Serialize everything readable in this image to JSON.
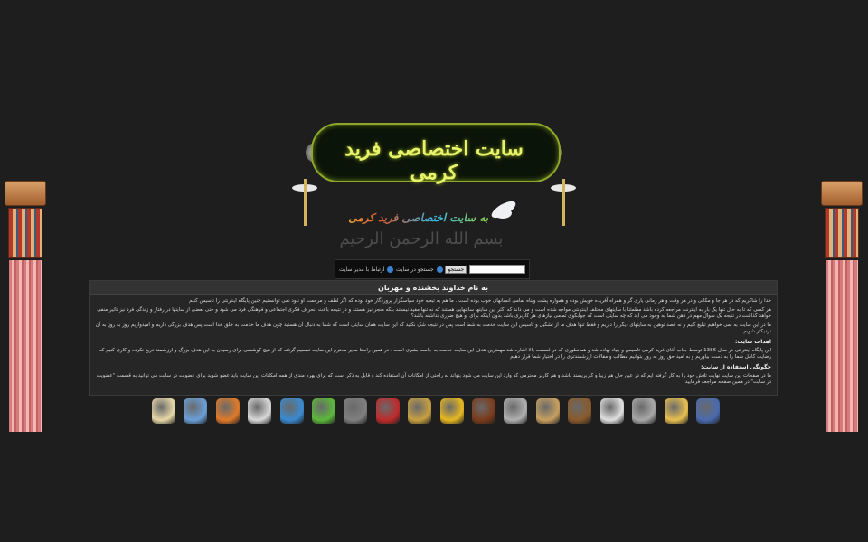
{
  "banner": {
    "title": "سایت اختصاصی فرید کرمی"
  },
  "welcome_text": "به سایت اختصاصی فرید کرمی",
  "basmala": "بسم الله الرحمن الرحیم",
  "navbar": {
    "search_button": "جستجو",
    "search_label": "جستجو در سایت",
    "contact_label": "ارتباط با مدیر سایت"
  },
  "content": {
    "heading": "به نام خداوند بخشنده و مهربان",
    "intro": "خدا را شاکریم که در هر جا و مکانی و در هر وقت و هر زمانی یاری گر و همراه آفریده خویش بوده و همواره پشت وپناه تمامی انسانهای خوب بوده است . ما هم به تبعیه خود سپاسگزار پروردگار خود بوده که اگر لطف و مرحمت او نبود نمی توانستیم چنین پایگاه اینترنتی را تاسیس کنیم",
    "intro2": "هر کسی که تا به حال تنها یک بار به اینترنت مراجعه کرده باشد مطمئنا با سایتهای مختلف اینترنتی مواجه شده است و می داند که اکثر این سایتها سایتهایی هستند که نه تنها مفید نیستند بلکه منجر نیز هستند و در نتیجه باعث انحراف فکری اجتماعی و فرهنگی فرد می شود و حتی بعضی از سایتها در رفتار و زندگی فرد نیز تاثیر منفی خواهد گذاشت در نتیجه یک سوال مهم در ذهن شما به وجود می آید که چه سایتی است که جوابگوی تمامی نیازهای هر کاربری باشد بدون اینکه برای او هیچ ضرری نداشته باشد؟",
    "intro3": "ما در این سایت به نمی خواهیم تبلیغ کنیم و نه قصد توهین به سایتهای دیگر را داریم و فقط تنها هدف ما از تشکیل و تاسیس این سایت خدمت به شما است پس در نتیجه شک نکنید که این سایت همان سایتی است که شما به دنبال آن هستید چون هدف ما خدمت به خلق خدا است پس هدف بزرگی داریم و امیدواریم روز به روز به آن نزدیکتر شویم",
    "goals_title": "اهداف سایت:",
    "goals_text": "این پایگاه اینترنتی در سال 1386 توسط جناب آقای فرید کرمی تاسیس و بنیاد نهاده شد و همانطوری که در قسمت بالا اشاره شد مهمترین هدف این سایت خدمت به جامعه بشری است . در همین راستا مدیر محترم این سایت تصمیم گرفته که از هیچ کوششی برای رسیدن به این هدف بزرگ و ارزشمند دریغ نکرده و کاری کنیم که رضایت کامل شما را به دست بیاوریم و به امید حق روز به روز بتوانیم مطالب و مقالات ارزشمندتری را در اختیار شما قرار دهیم",
    "usage_title": "چگونگی استفاده از سایت:",
    "usage_text": "ما در صفحات این سایت نهایت تلاش خود را به کار گرفته ایم که در عین حال هم زیبا و کاربرپسند باشد و هم کاربر محترمی که وارد این سایت می شود بتواند به راحتی از امکانات آن استفاده کند و قابل به ذکر است که برای بهره مندی از همه امکانات این سایت باید عضو شوید برای عضویت در سایت می توانید به قسمت \"عضویت در سایت\" در همین صفحه مراجعه فرمایید"
  },
  "icons": [
    "book-icon",
    "cities-icon",
    "cartoon-icon",
    "cartoon-face-icon",
    "question-box-icon",
    "parrot-icon",
    "globe-icon",
    "roses-icon",
    "guitar-icon",
    "allah-calligraphy-icon",
    "book-brown-icon",
    "computer-icon",
    "people-icon",
    "film-icon",
    "megaphone-icon",
    "shrine-icon",
    "genie-icon",
    "earth-icon"
  ],
  "icon_colors": [
    "#e8d8a8",
    "#6aa0d8",
    "#e07a2a",
    "#d8d8d8",
    "#3a8ad0",
    "#5cb83a",
    "#808080",
    "#c02a2a",
    "#c8a040",
    "#e8b820",
    "#7a3a1a",
    "#b0b0b0",
    "#c8a060",
    "#8a5a2a",
    "#e0e0e0",
    "#a8a8a8",
    "#e8c050",
    "#4a6ab0"
  ]
}
